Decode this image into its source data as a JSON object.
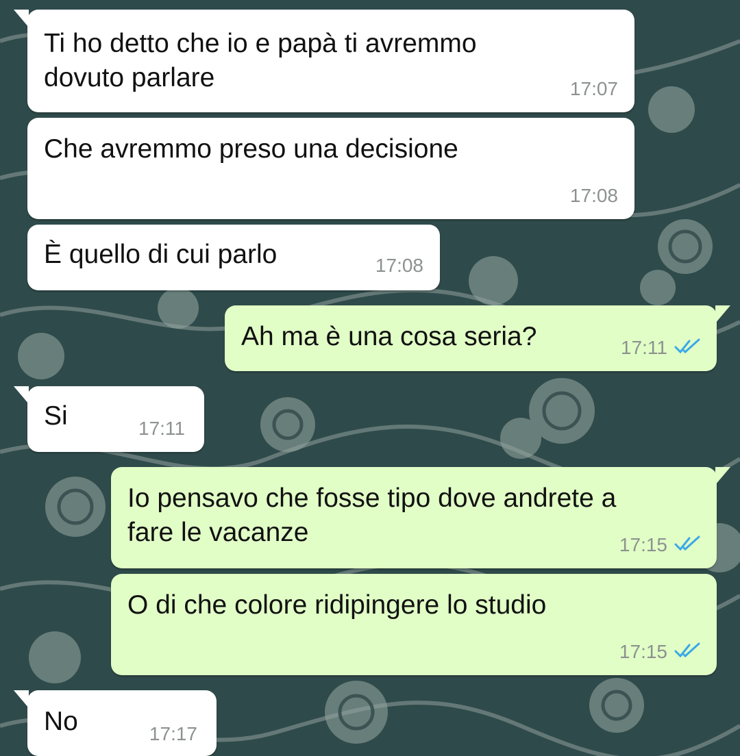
{
  "messages": [
    {
      "direction": "incoming",
      "lines": [
        "Ti ho detto che io e papà ti avremmo",
        "dovuto parlare"
      ],
      "time": "17:07"
    },
    {
      "direction": "incoming",
      "lines": [
        "Che avremmo preso una decisione"
      ],
      "time": "17:08"
    },
    {
      "direction": "incoming",
      "lines": [
        "È quello di cui parlo"
      ],
      "time": "17:08"
    },
    {
      "direction": "outgoing",
      "lines": [
        "Ah ma è una cosa seria?"
      ],
      "time": "17:11",
      "status": "read"
    },
    {
      "direction": "incoming",
      "lines": [
        "Si"
      ],
      "time": "17:11"
    },
    {
      "direction": "outgoing",
      "lines": [
        "Io pensavo che fosse tipo dove andrete a",
        "fare le vacanze"
      ],
      "time": "17:15",
      "status": "read"
    },
    {
      "direction": "outgoing",
      "lines": [
        "O di che colore ridipingere lo studio"
      ],
      "time": "17:15",
      "status": "read"
    },
    {
      "direction": "incoming",
      "lines": [
        "No"
      ],
      "time": "17:17"
    }
  ],
  "colors": {
    "wallpaper": "#2f4a4a",
    "wallpaper_pattern": "#8fa19d",
    "incoming_bubble": "#ffffff",
    "outgoing_bubble": "#e1fec6",
    "timestamp": "#8c928f",
    "read_ticks": "#3aa8e8"
  },
  "icons": {
    "read_status": "double-check-icon"
  }
}
